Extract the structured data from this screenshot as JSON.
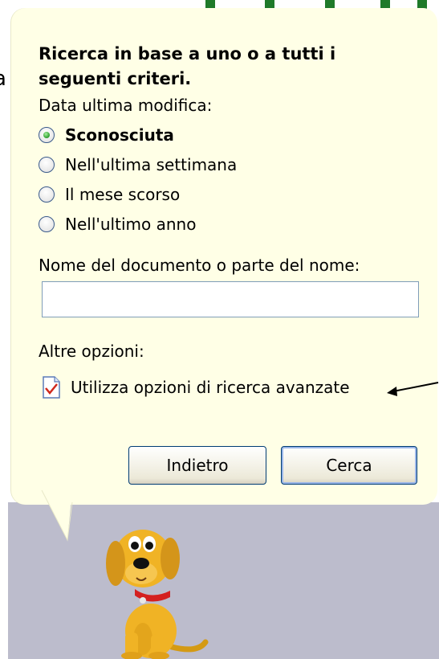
{
  "assistant": {
    "heading": "Ricerca in base a uno o a tutti i seguenti criteri.",
    "date_label": "Data ultima modifica:",
    "date_options": [
      {
        "label": "Sconosciuta",
        "selected": true
      },
      {
        "label": "Nell'ultima settimana",
        "selected": false
      },
      {
        "label": "Il mese scorso",
        "selected": false
      },
      {
        "label": "Nell'ultimo anno",
        "selected": false
      }
    ],
    "name_label": "Nome del documento o parte del nome:",
    "name_value": "",
    "other_label": "Altre opzioni:",
    "advanced_link": "Utilizza opzioni di ricerca avanzate",
    "back_button": "Indietro",
    "search_button": "Cerca"
  },
  "background": {
    "left_fragment": "a"
  },
  "colors": {
    "balloon": "#ffffe6",
    "accent_green": "#1f7a2a",
    "button_border": "#003c74"
  },
  "icons": [
    "radio-icon",
    "document-icon",
    "arrow-pointer",
    "dog-assistant"
  ]
}
